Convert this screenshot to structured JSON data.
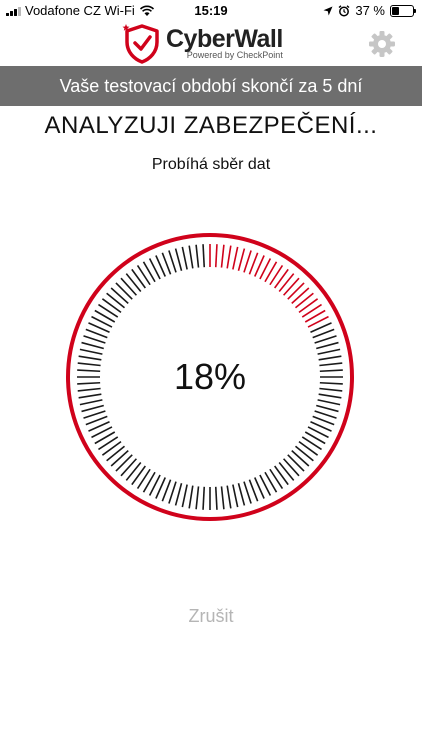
{
  "status_bar": {
    "carrier": "Vodafone CZ Wi-Fi",
    "time": "15:19",
    "battery": "37 %",
    "battery_level": 0.37
  },
  "header": {
    "brand": "CyberWall",
    "brand_sub": "Powered by CheckPoint",
    "icons": [
      "shield-check-icon",
      "gear-icon"
    ]
  },
  "banner": {
    "text": "Vaše testovací období skončí za 5 dní"
  },
  "title": "ANALYZUJI ZABEZPEČENÍ...",
  "subtitle": "Probíhá sběr dat",
  "progress": {
    "label": "18%",
    "value": 0.18,
    "accent": "#d0021b",
    "tick_color": "#1a1a1a"
  },
  "cancel_label": "Zrušit"
}
